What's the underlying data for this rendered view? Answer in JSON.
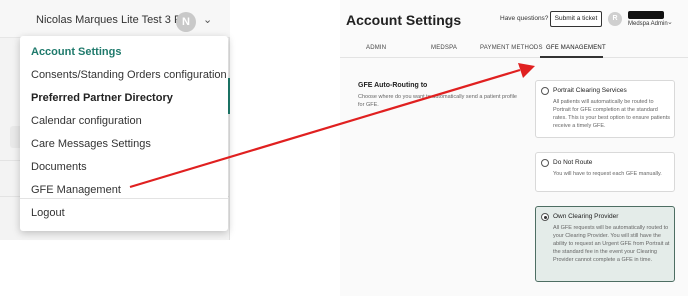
{
  "left_menu": {
    "user_name": "Nicolas Marques Lite Test 3 RN",
    "avatar_initial": "N",
    "items": [
      {
        "label": "Account Settings"
      },
      {
        "label": "Consents/Standing Orders configuration"
      },
      {
        "label": "Preferred Partner Directory"
      },
      {
        "label": "Calendar configuration"
      },
      {
        "label": "Care Messages Settings"
      },
      {
        "label": "Documents"
      },
      {
        "label": "GFE Management"
      },
      {
        "label": "Logout"
      }
    ]
  },
  "settings": {
    "title": "Account Settings",
    "have_questions": "Have questions?",
    "submit_ticket": "Submit a ticket",
    "avatar_initial": "R",
    "role": "Medspa Admin",
    "tabs": [
      {
        "label": "ADMIN"
      },
      {
        "label": "MEDSPA"
      },
      {
        "label": "PAYMENT METHODS"
      },
      {
        "label": "GFE MANAGEMENT"
      }
    ],
    "active_tab": "GFE MANAGEMENT",
    "section_title": "GFE Auto-Routing to",
    "section_desc": "Choose where do you want to automatically send a patient profile for GFE.",
    "options": [
      {
        "title": "Portrait Clearing Services",
        "desc": "All patients will automatically be routed to Portrait for GFE completion at the standard rates. This is your best option to ensure patients receive a timely GFE.",
        "selected": false
      },
      {
        "title": "Do Not Route",
        "desc": "You will have to request each GFE manually.",
        "selected": false
      },
      {
        "title": "Own Clearing Provider",
        "desc": "All GFE requests will be automatically routed to your Clearing Provider. You will still have the ability to request an Urgent GFE from Portrait at the standard fee in the event your Clearing Provider cannot complete a GFE in time.",
        "selected": true
      }
    ]
  },
  "colors": {
    "accent": "#1f7a6c",
    "arrow": "#e02020"
  }
}
